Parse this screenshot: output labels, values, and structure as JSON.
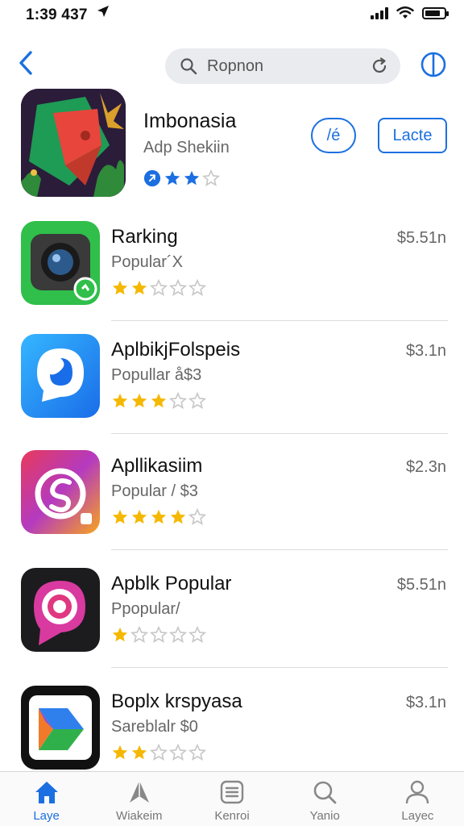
{
  "status_bar": {
    "time": "1:39 437",
    "location_icon": "location-arrow-icon"
  },
  "search": {
    "placeholder": "Ropnon"
  },
  "featured": {
    "title": "Imbonasia",
    "subtitle": "Adp Shekiin",
    "get_label": "/é",
    "later_label": "Lacte",
    "rating": 2
  },
  "apps": [
    {
      "name": "Rarking",
      "subtitle": "Popular´X",
      "price": "$5.51n",
      "rating": 2,
      "icon": "camera-app-icon"
    },
    {
      "name": "AplbikjFolspeis",
      "subtitle": "Popullar å$3",
      "price": "$3.1n",
      "rating": 3,
      "icon": "chat-bubble-app-icon"
    },
    {
      "name": "Apllikasiim",
      "subtitle": "Popular / $3",
      "price": "$2.3n",
      "rating": 4,
      "icon": "gradient-s-app-icon"
    },
    {
      "name": "Apblk Popular",
      "subtitle": "Ppopular/",
      "price": "$5.51n",
      "rating": 1,
      "icon": "target-chat-app-icon"
    },
    {
      "name": "Boplx krspyasa",
      "subtitle": "Sareblalr $0",
      "price": "$3.1n",
      "rating": 2,
      "icon": "folded-document-app-icon"
    }
  ],
  "tabs": [
    {
      "label": "Laye",
      "icon": "home-icon",
      "active": true
    },
    {
      "label": "Wiakeim",
      "icon": "games-icon",
      "active": false
    },
    {
      "label": "Kenroi",
      "icon": "apps-icon",
      "active": false
    },
    {
      "label": "Yanio",
      "icon": "search-icon",
      "active": false
    },
    {
      "label": "Layec",
      "icon": "person-icon",
      "active": false
    }
  ],
  "colors": {
    "accent": "#1b6fe0",
    "star": "#f5b800",
    "star_empty": "#c8c8c8"
  }
}
